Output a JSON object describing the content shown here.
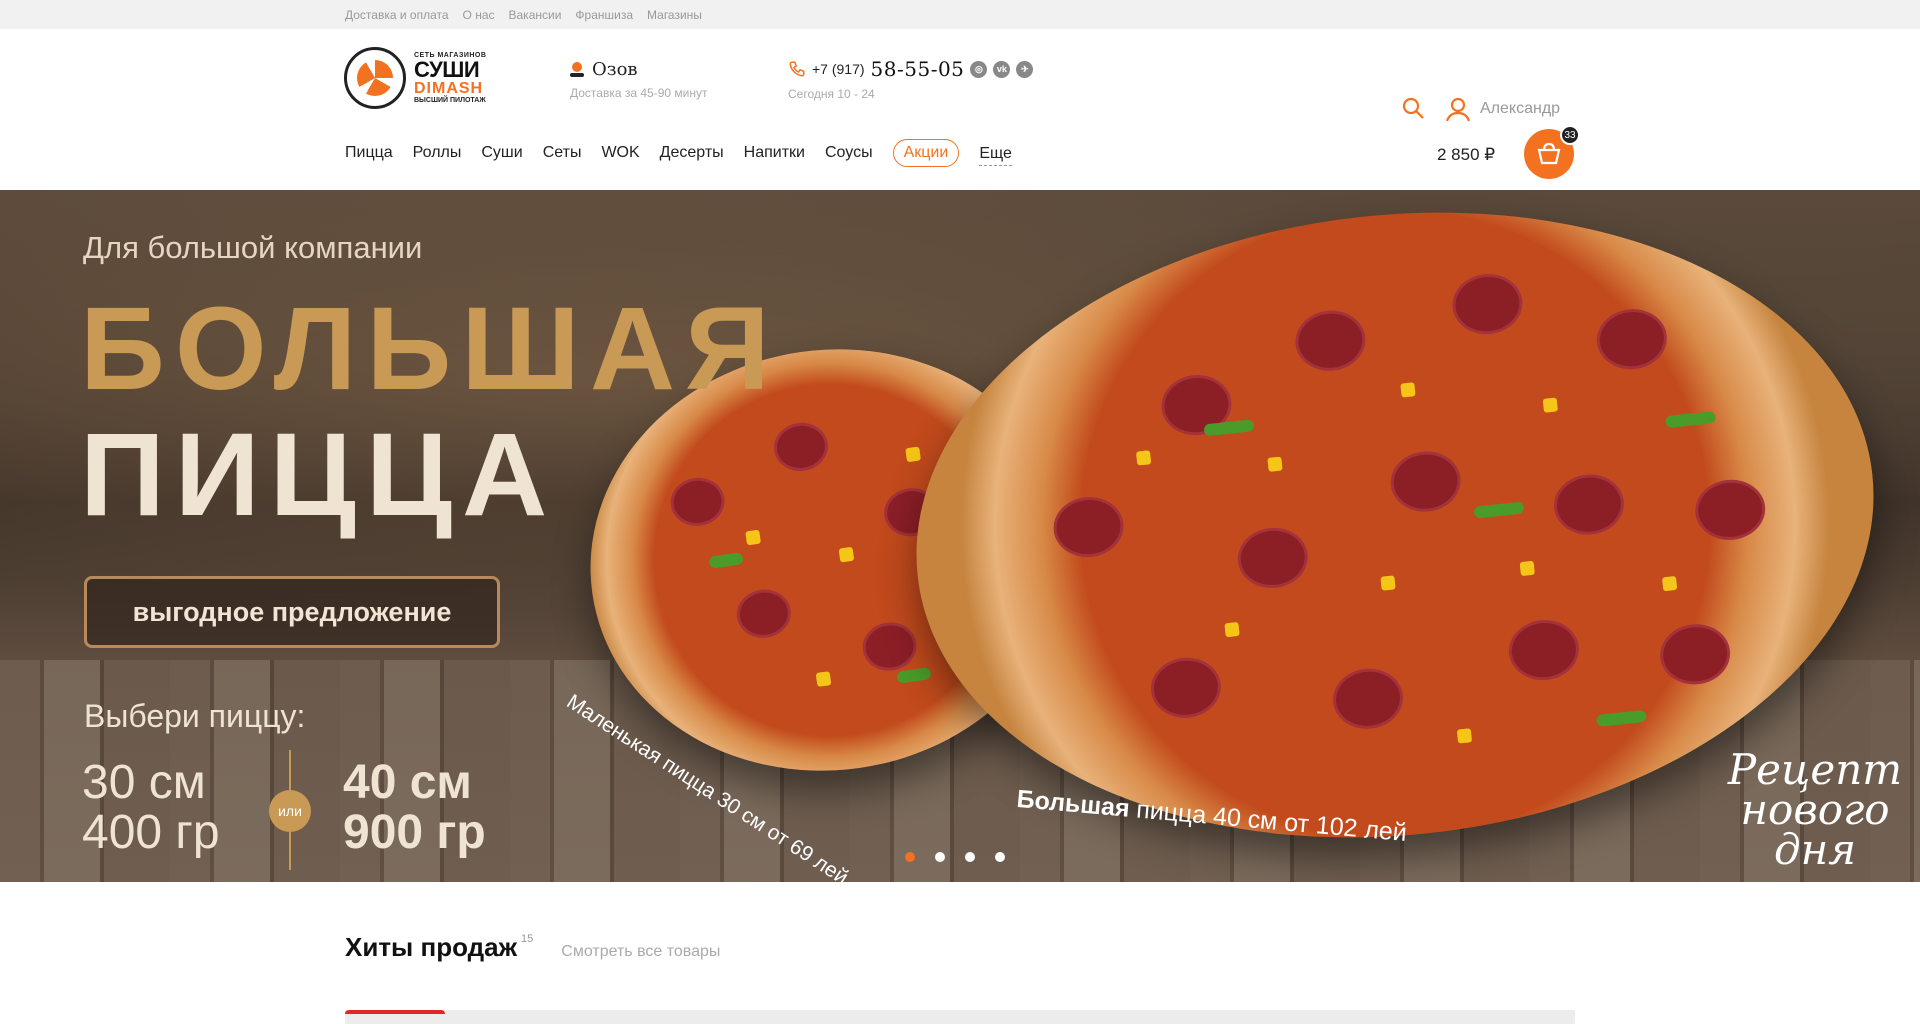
{
  "topbar": {
    "links": [
      "Доставка и оплата",
      "О нас",
      "Вакансии",
      "Франшиза",
      "Магазины"
    ]
  },
  "logo": {
    "small": "СЕТЬ МАГАЗИНОВ",
    "big": "СУШИ",
    "brand": "DIMASH",
    "sub": "ВЫСШИЙ ПИЛОТАЖ"
  },
  "city": {
    "name": "Озов",
    "note": "Доставка за 45-90 минут"
  },
  "phone": {
    "prefix": "+7 (917)",
    "number": "58-55-05",
    "hours": "Сегодня 10 - 24"
  },
  "user": {
    "name": "Александр"
  },
  "nav": {
    "items": [
      "Пицца",
      "Роллы",
      "Суши",
      "Сеты",
      "WOK",
      "Десерты",
      "Напитки",
      "Соусы"
    ],
    "promo": "Акции",
    "more": "Еще"
  },
  "cart": {
    "total": "2 850 ₽",
    "count": "33"
  },
  "hero": {
    "tag": "Для большой компании",
    "title1": "БОЛЬШАЯ",
    "title2": "ПИЦЦА",
    "offer": "выгодное предложение",
    "choose": "Выбери пиццу:",
    "size_a_cm": "30 см",
    "size_a_gr": "400 гр",
    "or": "или",
    "size_b_cm": "40 см",
    "size_b_gr": "900 гр",
    "cap_small": "Маленькая пицца 30 см от 69 лей",
    "cap_big_bold": "Большая",
    "cap_big_rest": " пицца 40 см от 102 лей",
    "script": "Рецепт нового дня",
    "slides": 4,
    "active_slide": 0
  },
  "hits": {
    "title": "Хиты продаж",
    "count": "15",
    "link": "Смотреть все товары"
  },
  "colors": {
    "accent": "#f4721f",
    "gold": "#c99956"
  }
}
